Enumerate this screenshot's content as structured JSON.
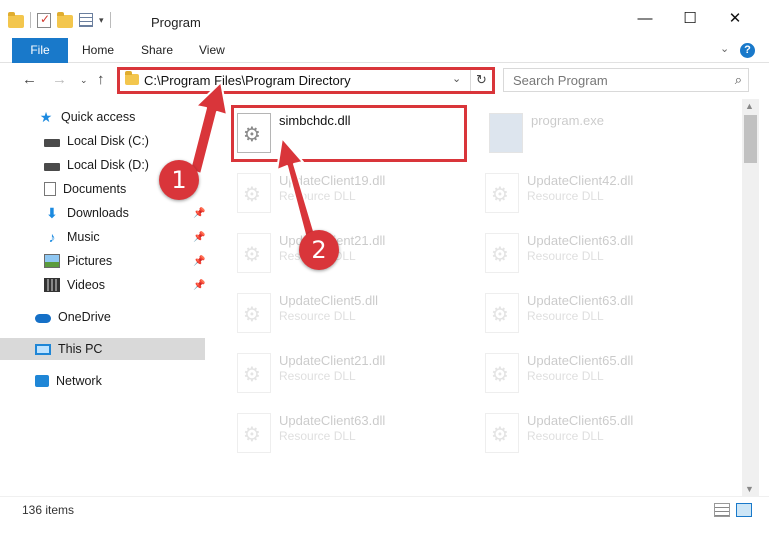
{
  "window": {
    "title": "Program",
    "controls": {
      "minimize": "—",
      "maximize": "☐",
      "close": "✕"
    }
  },
  "ribbon": {
    "tabs": [
      {
        "label": "File"
      },
      {
        "label": "Home"
      },
      {
        "label": "Share"
      },
      {
        "label": "View"
      }
    ],
    "help": "?"
  },
  "address": {
    "path": "C:\\Program Files\\Program Directory",
    "search_placeholder": "Search Program"
  },
  "sidebar": {
    "items": [
      {
        "label": "Quick access",
        "icon": "star-icon",
        "pinned": false
      },
      {
        "label": "Local Disk (C:)",
        "icon": "drive-icon",
        "pinned": false
      },
      {
        "label": "Local Disk (D:)",
        "icon": "drive-icon",
        "pinned": true
      },
      {
        "label": "Documents",
        "icon": "documents-icon",
        "pinned": false
      },
      {
        "label": "Downloads",
        "icon": "download-icon",
        "pinned": true
      },
      {
        "label": "Music",
        "icon": "music-icon",
        "pinned": true
      },
      {
        "label": "Pictures",
        "icon": "pictures-icon",
        "pinned": true
      },
      {
        "label": "Videos",
        "icon": "videos-icon",
        "pinned": true
      },
      {
        "label": "OneDrive",
        "icon": "onedrive-icon",
        "pinned": false
      },
      {
        "label": "This PC",
        "icon": "this-pc-icon",
        "pinned": false,
        "selected": true
      },
      {
        "label": "Network",
        "icon": "network-icon",
        "pinned": false
      }
    ]
  },
  "files": {
    "highlighted": {
      "name": "simbchdc.dll"
    },
    "exe": {
      "name": "program.exe"
    },
    "items": [
      {
        "name": "UpdateClient19.dll",
        "desc": "Resource DLL"
      },
      {
        "name": "UpdateClient42.dll",
        "desc": "Resource DLL"
      },
      {
        "name": "UpdateClient21.dll",
        "desc": "Resource DLL"
      },
      {
        "name": "UpdateClient63.dll",
        "desc": "Resource DLL"
      },
      {
        "name": "UpdateClient5.dll",
        "desc": "Resource DLL"
      },
      {
        "name": "UpdateClient63.dll",
        "desc": "Resource DLL"
      },
      {
        "name": "UpdateClient21.dll",
        "desc": "Resource DLL"
      },
      {
        "name": "UpdateClient65.dll",
        "desc": "Resource DLL"
      },
      {
        "name": "UpdateClient63.dll",
        "desc": "Resource DLL"
      },
      {
        "name": "UpdateClient65.dll",
        "desc": "Resource DLL"
      }
    ]
  },
  "annotations": {
    "step1": "1",
    "step2": "2",
    "color": "#d9353a"
  },
  "status": {
    "count": "136 items"
  }
}
